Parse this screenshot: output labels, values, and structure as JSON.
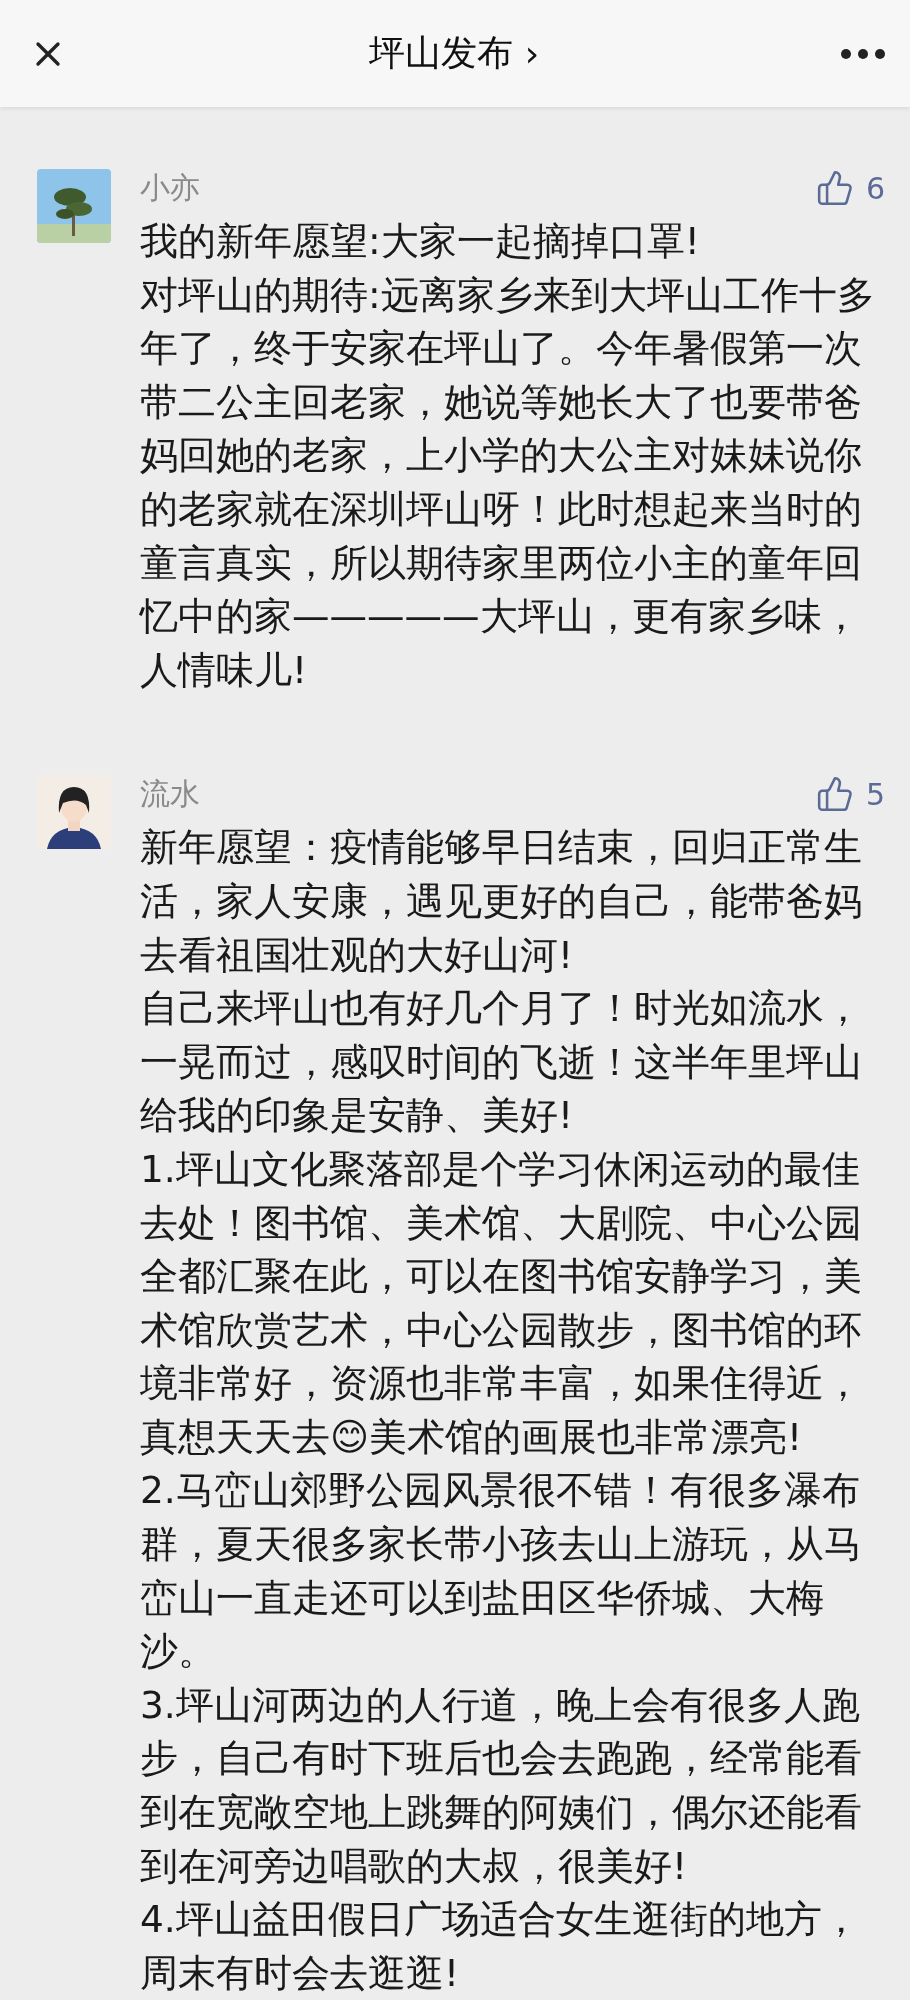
{
  "header": {
    "title": "坪山发布",
    "title_arrow": "›"
  },
  "comments": [
    {
      "name": "小亦",
      "likes": "6",
      "avatar": {
        "kind": "picture"
      },
      "paragraphs": [
        [
          {
            "kind": "text",
            "text": "我的新年愿望:大家一起摘掉口罩!"
          }
        ],
        [
          {
            "kind": "text",
            "text": "对坪山的期待:远离家乡来到大坪山工作十多年了，终于安家在坪山了。今年暑假第一次带二公主回老家，她说等她长大了也要带爸妈回她的老家，上小学的大公主对妹妹说你的老家就在深圳坪山呀！此时想起来当时的童言真实，所以期待家里两位小主的童年回忆中的家—————大坪山，更有家乡味，人情味儿!"
          }
        ]
      ]
    },
    {
      "name": "流水",
      "likes": "5",
      "avatar": {
        "kind": "picture"
      },
      "paragraphs": [
        [
          {
            "kind": "text",
            "text": "新年愿望：疫情能够早日结束，回归正常生活，家人安康，遇见更好的自己，能带爸妈去看祖国壮观的大好山河!"
          }
        ],
        [
          {
            "kind": "text",
            "text": "自己来坪山也有好几个月了！时光如流水，一晃而过，感叹时间的飞逝！这半年里坪山给我的印象是安静、美好!"
          }
        ],
        [
          {
            "kind": "text",
            "text": "1.坪山文化聚落部是个学习休闲运动的最佳去处！图书馆、美术馆、大剧院、中心公园全都汇聚在此，可以在图书馆安静学习，美术馆欣赏艺术，中心公园散步，图书馆的环境非常好，资源也非常丰富，如果住得近，真想天天去😊美术馆的画展也非常漂亮!"
          }
        ],
        [
          {
            "kind": "text",
            "text": "2.马峦山郊野公园风景很不错！有很多瀑布群，夏天很多家长带小孩去山上游玩，从马峦山一直走还可以到盐田区华侨城、大梅沙。"
          }
        ],
        [
          {
            "kind": "text",
            "text": "3.坪山河两边的人行道，晚上会有很多人跑步，自己有时下班后也会去跑跑，经常能看到在宽敞空地上跳舞的阿姨们，偶尔还能看到在河旁边唱歌的大叔，很美好!"
          }
        ],
        [
          {
            "kind": "text",
            "text": "4.坪山益田假日广场适合女生逛街的地方，周末有时会去逛逛!"
          }
        ]
      ]
    }
  ]
}
